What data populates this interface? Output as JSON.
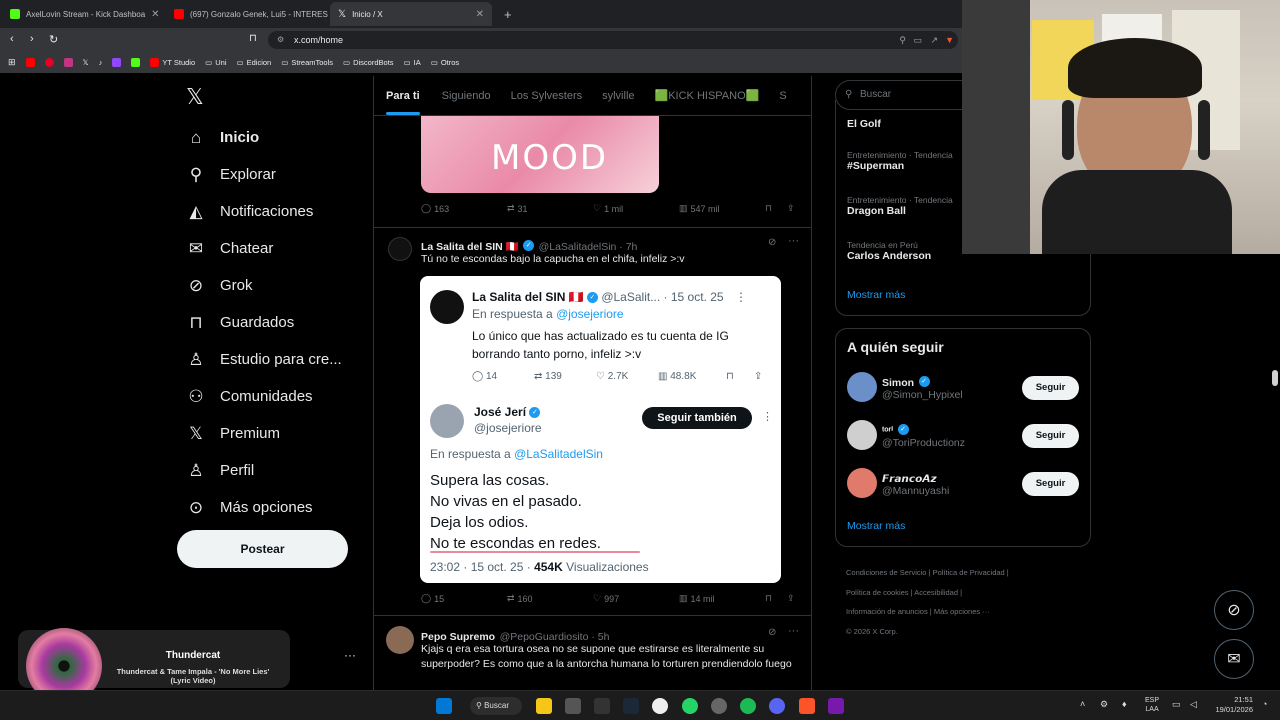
{
  "browser": {
    "tabs": [
      {
        "label": "AxelLovin Stream - Kick Dashboa",
        "color": "#53fc18"
      },
      {
        "label": "(697) Gonzalo Genek, Lui5 - INTERES",
        "color": "#ff0000"
      },
      {
        "label": "Inicio / X",
        "color": "#ffffff"
      }
    ],
    "new_tab": "+",
    "url": "x.com/home",
    "bookmarks": [
      "YT Studio",
      "Uni",
      "Edicion",
      "StreamTools",
      "DiscordBots",
      "IA",
      "Otros"
    ]
  },
  "nav": {
    "items": [
      {
        "label": "Inicio",
        "icon": "home-icon",
        "glyph": "⌂"
      },
      {
        "label": "Explorar",
        "icon": "search-icon",
        "glyph": "⚲"
      },
      {
        "label": "Notificaciones",
        "icon": "bell-icon",
        "glyph": "🔔"
      },
      {
        "label": "Chatear",
        "icon": "mail-icon",
        "glyph": "✉"
      },
      {
        "label": "Grok",
        "icon": "grok-icon",
        "glyph": "⊘"
      },
      {
        "label": "Guardados",
        "icon": "bookmark-icon",
        "glyph": "⊓"
      },
      {
        "label": "Estudio para cre...",
        "icon": "studio-icon",
        "glyph": "♙"
      },
      {
        "label": "Comunidades",
        "icon": "communities-icon",
        "glyph": "⚇"
      },
      {
        "label": "Premium",
        "icon": "x-logo-icon",
        "glyph": "𝕏"
      },
      {
        "label": "Perfil",
        "icon": "profile-icon",
        "glyph": "♙"
      },
      {
        "label": "Más opciones",
        "icon": "more-icon",
        "glyph": "⊙"
      }
    ],
    "post_button": "Postear"
  },
  "spotify": {
    "artist": "Thundercat",
    "track": "Thundercat & Tame Impala - 'No More Lies' (Lyric Video)"
  },
  "feed": {
    "tabs": [
      "Para ti",
      "Siguiendo",
      "Los Sylvesters",
      "sylville",
      "🟩KICK HISPANO🟩",
      "S"
    ],
    "post1": {
      "image_text": "MOOD",
      "replies": "163",
      "reposts": "31",
      "likes": "1 mil",
      "views": "547 mil"
    },
    "post2": {
      "name": "La Salita del SIN 🇵🇪",
      "handle": "@LaSalitadelSin · 7h",
      "text": "Tú no te escondas bajo la capucha en el chifa, infeliz >:v",
      "quote": {
        "name": "La Salita del SIN 🇵🇪",
        "handle": "@LaSalit...",
        "date": "· 15 oct. 25",
        "reply_to_label": "En respuesta a",
        "reply_to": "@josejeriore",
        "text": "Lo único que has actualizado es tu cuenta de IG borrando tanto porno, infeliz >:v",
        "replies": "14",
        "reposts": "139",
        "likes": "2.7K",
        "views": "48.8K",
        "reply_name": "José Jerí",
        "reply_handle": "@josejeriore",
        "follow_label": "Seguir también",
        "reply_reply_to": "@LaSalitadelSin",
        "lines": [
          "Supera las cosas.",
          "No vivas en el pasado.",
          "Deja los odios.",
          "No te escondas en redes."
        ],
        "time": "23:02 · 15 oct. 25 ·",
        "views_count": "454K",
        "views_label": "Visualizaciones"
      },
      "replies": "15",
      "reposts": "160",
      "likes": "997",
      "views": "14 mil"
    },
    "post3": {
      "name": "Pepo Supremo",
      "handle": "@PepoGuardiosito · 5h",
      "text": "Kjajs q era esa tortura osea no se supone que estirarse es literalmente su superpoder? Es como que a la antorcha humana lo torturen prendiendolo fuego"
    }
  },
  "right": {
    "search_placeholder": "Buscar",
    "trends": [
      {
        "cat": "",
        "name": "El Golf"
      },
      {
        "cat": "Entretenimiento · Tendencia",
        "name": "#Superman"
      },
      {
        "cat": "Entretenimiento · Tendencia",
        "name": "Dragon Ball"
      },
      {
        "cat": "Tendencia en Perú",
        "name": "Carlos Anderson"
      }
    ],
    "show_more": "Mostrar más",
    "who_to_follow": "A quién seguir",
    "follow_label": "Seguir",
    "accounts": [
      {
        "name": "Simon",
        "handle": "@Simon_Hypixel",
        "color": "#6a8fc9"
      },
      {
        "name": "ᵗᵒʳⁱ",
        "handle": "@ToriProductionz",
        "color": "#cfcfcf"
      },
      {
        "name": "𝙁𝙧𝙖𝙣𝙘𝙤𝘼𝙯",
        "handle": "@Mannuyashi",
        "color": "#e07a6a"
      }
    ],
    "footer": [
      "Condiciones de Servicio",
      "Política de Privacidad",
      "Política de cookies",
      "Accesibilidad",
      "Información de anuncios",
      "Más opciones ···",
      "© 2026 X Corp."
    ]
  },
  "taskbar": {
    "search": "Buscar",
    "lang": "ESP",
    "lang2": "LAA",
    "time": "21:51",
    "date": "19/01/2026"
  }
}
